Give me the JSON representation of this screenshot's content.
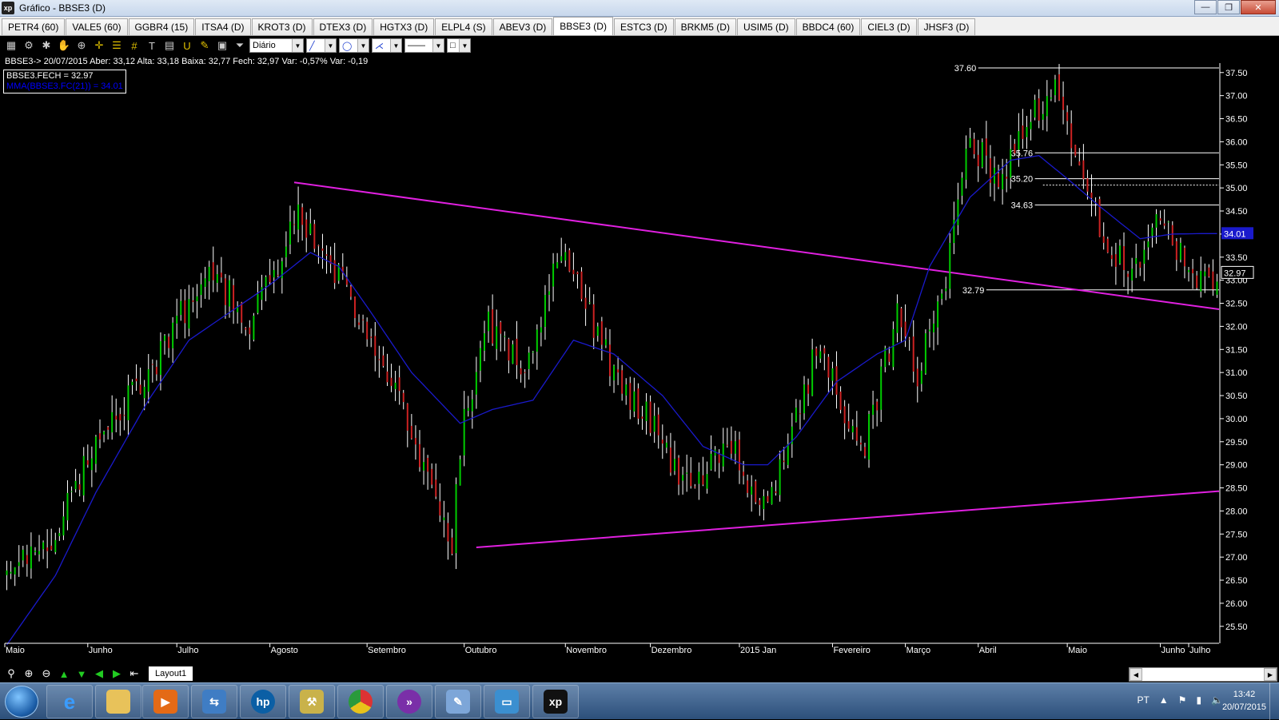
{
  "window": {
    "title": "Gráfico - BBSE3 (D)",
    "app_icon": "xp",
    "minimize": "—",
    "restore": "❐",
    "close": "✕"
  },
  "tabs": [
    "PETR4 (60)",
    "VALE5 (60)",
    "GGBR4 (15)",
    "ITSA4 (D)",
    "KROT3 (D)",
    "DTEX3 (D)",
    "HGTX3 (D)",
    "ELPL4 (S)",
    "ABEV3 (D)",
    "BBSE3 (D)",
    "ESTC3 (D)",
    "BRKM5 (D)",
    "USIM5 (D)",
    "BBDC4 (60)",
    "CIEL3 (D)",
    "JHSF3 (D)"
  ],
  "active_tab": "BBSE3 (D)",
  "toolbar": {
    "period_value": "Diário",
    "period_arrow": "▼",
    "line_arrow": "▼",
    "shape_arrow": "▼",
    "style_arrow": "▼"
  },
  "info_line": "BBSE3-> 20/07/2015 Aber: 33,12 Alta: 33,18 Baixa: 32,77 Fech: 32,97 Var: -0,57% Var: -0,19",
  "legend": {
    "price": "BBSE3.FECH = 32.97",
    "ma": "MMA(BBSE3.FC(21)) = 34.01"
  },
  "bottom": {
    "layout_tab": "Layout1"
  },
  "taskbar": {
    "language": "PT",
    "time": "13:42",
    "date": "20/07/2015"
  },
  "colors": {
    "up": "#00cc00",
    "down": "#cc2222",
    "wick": "#ffffff",
    "ma": "#1a1acc",
    "trendline": "#e020e0",
    "level": "#ffffff"
  },
  "chart_data": {
    "type": "candlestick",
    "symbol": "BBSE3",
    "ylim": [
      25.2,
      37.7
    ],
    "yticks": [
      25.5,
      26.0,
      26.5,
      27.0,
      27.5,
      28.0,
      28.5,
      29.0,
      29.5,
      30.0,
      30.5,
      31.0,
      31.5,
      32.0,
      32.5,
      33.0,
      33.5,
      34.0,
      34.5,
      35.0,
      35.5,
      36.0,
      36.5,
      37.0,
      37.5
    ],
    "months": [
      "Maio",
      "Junho",
      "Julho",
      "Agosto",
      "Setembro",
      "Outubro",
      "Novembro",
      "Dezembro",
      "2015 Jan",
      "Fevereiro",
      "Março",
      "Abril",
      "Maio",
      "Junho",
      "Julho"
    ],
    "last_close": 32.97,
    "ma_last": 34.01,
    "levels": [
      37.6,
      35.76,
      35.2,
      34.63,
      32.79
    ],
    "dashed_level": 35.06,
    "closes_key": [
      [
        0,
        26.9
      ],
      [
        10,
        27.2
      ],
      [
        22,
        29.4
      ],
      [
        35,
        31.0
      ],
      [
        50,
        33.3
      ],
      [
        60,
        32.0
      ],
      [
        72,
        34.4
      ],
      [
        80,
        33.4
      ],
      [
        88,
        32.2
      ],
      [
        95,
        30.9
      ],
      [
        105,
        28.6
      ],
      [
        110,
        27.4
      ],
      [
        113,
        29.9
      ],
      [
        119,
        32.0
      ],
      [
        128,
        31.2
      ],
      [
        137,
        33.6
      ],
      [
        142,
        32.7
      ],
      [
        150,
        31.0
      ],
      [
        160,
        29.8
      ],
      [
        168,
        28.5
      ],
      [
        178,
        29.5
      ],
      [
        186,
        28.2
      ],
      [
        192,
        29.0
      ],
      [
        200,
        31.5
      ],
      [
        207,
        30.2
      ],
      [
        212,
        29.5
      ],
      [
        220,
        32.2
      ],
      [
        225,
        31.0
      ],
      [
        232,
        33.0
      ],
      [
        238,
        36.0
      ],
      [
        245,
        35.2
      ],
      [
        252,
        36.3
      ],
      [
        259,
        37.3
      ],
      [
        265,
        35.5
      ],
      [
        272,
        33.6
      ],
      [
        280,
        33.2
      ],
      [
        285,
        34.5
      ],
      [
        292,
        33.2
      ],
      [
        295,
        33.1
      ]
    ],
    "ma_key": [
      [
        0,
        25.1
      ],
      [
        12,
        26.6
      ],
      [
        22,
        28.4
      ],
      [
        35,
        30.4
      ],
      [
        45,
        31.7
      ],
      [
        55,
        32.3
      ],
      [
        65,
        32.9
      ],
      [
        75,
        33.6
      ],
      [
        82,
        33.3
      ],
      [
        90,
        32.3
      ],
      [
        100,
        31.0
      ],
      [
        112,
        29.9
      ],
      [
        120,
        30.2
      ],
      [
        130,
        30.4
      ],
      [
        140,
        31.7
      ],
      [
        150,
        31.4
      ],
      [
        162,
        30.5
      ],
      [
        172,
        29.4
      ],
      [
        182,
        29.0
      ],
      [
        188,
        29.0
      ],
      [
        195,
        29.6
      ],
      [
        205,
        30.8
      ],
      [
        215,
        31.4
      ],
      [
        222,
        31.7
      ],
      [
        228,
        33.3
      ],
      [
        238,
        34.8
      ],
      [
        248,
        35.6
      ],
      [
        255,
        35.7
      ],
      [
        262,
        35.2
      ],
      [
        270,
        34.6
      ],
      [
        280,
        33.9
      ],
      [
        288,
        34.0
      ],
      [
        295,
        34.01
      ]
    ],
    "trendlines": [
      {
        "x": [
          71,
          299
        ],
        "y": [
          35.12,
          32.37
        ]
      },
      {
        "x": [
          116,
          299
        ],
        "y": [
          27.21,
          28.43
        ]
      }
    ]
  }
}
